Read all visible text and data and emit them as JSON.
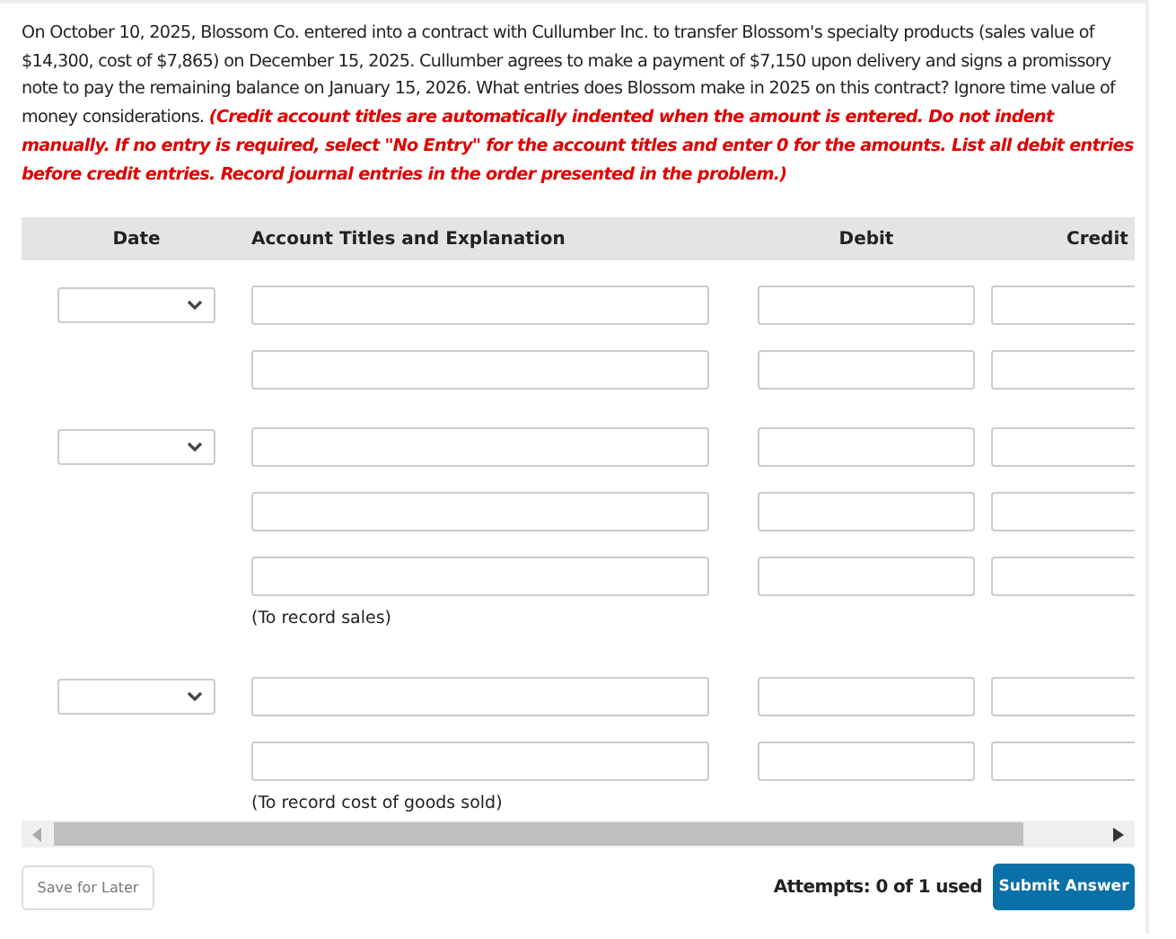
{
  "question": "On October 10, 2025, Blossom Co. entered into a contract with Cullumber Inc. to transfer Blossom's specialty products (sales value of $14,300, cost of $7,865) on December 15, 2025. Cullumber agrees to make a payment of $7,150 upon delivery and signs a promissory note to pay the remaining balance on January 15, 2026. What entries does Blossom make in 2025 on this contract? Ignore time value of money considerations. **(Credit account titles are automatically indented when the amount is entered. Do not indent manually. If no entry is required, select \"No Entry\" for the account titles and enter 0 for the amounts. List all debit entries before credit entries. Record journal entries in the order presented in the problem.)**",
  "table": {
    "columns": [
      "Date",
      "Account Titles and Explanation",
      "Debit",
      "Credit"
    ],
    "entries": [
      {
        "lines": [
          {
            "kind": "account"
          },
          {
            "kind": "account"
          }
        ]
      },
      {
        "lines": [
          {
            "kind": "account"
          },
          {
            "kind": "account"
          },
          {
            "kind": "account"
          }
        ],
        "note": "(To record sales)"
      },
      {
        "lines": [
          {
            "kind": "account"
          },
          {
            "kind": "account"
          }
        ],
        "note": "(To record cost of goods sold)"
      }
    ]
  },
  "footer": {
    "save": "Save for Later",
    "attempts": "Attempts: 0 of 1 used",
    "submit": "Submit Answer"
  }
}
